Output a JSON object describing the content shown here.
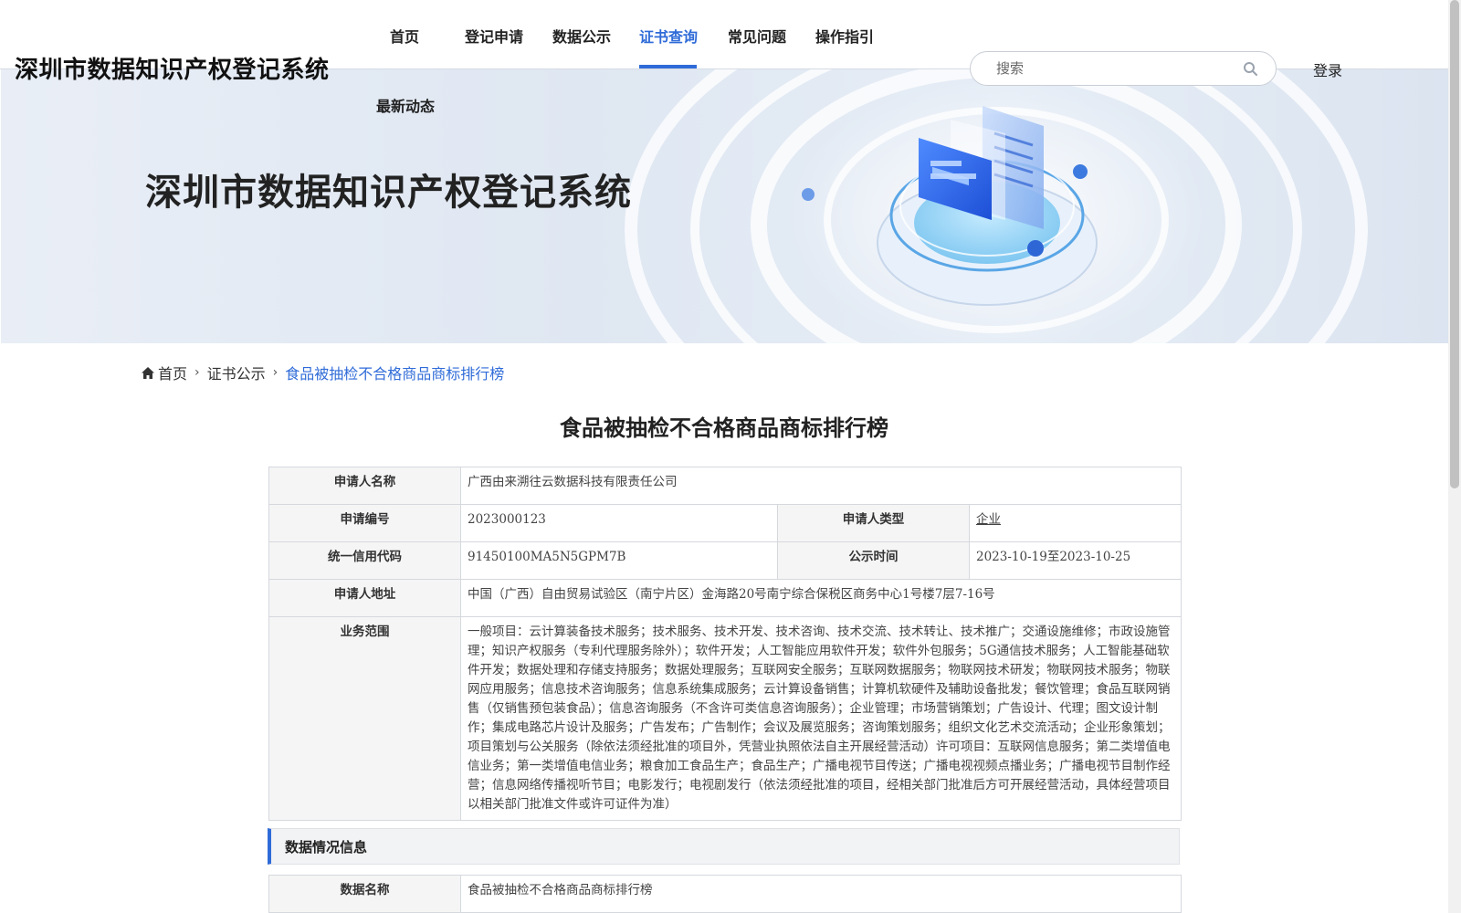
{
  "header": {
    "site_title": "深圳市数据知识产权登记系统",
    "nav": [
      {
        "label": "首页",
        "active": false
      },
      {
        "label": "登记申请",
        "active": false
      },
      {
        "label": "数据公示",
        "active": false
      },
      {
        "label": "证书查询",
        "active": true
      },
      {
        "label": "常见问题",
        "active": false
      },
      {
        "label": "操作指引",
        "active": false
      },
      {
        "label": "最新动态",
        "active": false
      }
    ],
    "search_placeholder": "搜索",
    "login_label": "登录",
    "accent_color": "#2f6bd8"
  },
  "banner": {
    "title": "深圳市数据知识产权登记系统"
  },
  "breadcrumb": {
    "items": [
      "首页",
      "证书公示",
      "食品被抽检不合格商品商标排行榜"
    ]
  },
  "page": {
    "title": "食品被抽检不合格商品商标排行榜"
  },
  "applicant": {
    "name_label": "申请人名称",
    "name": "广西由来溯往云数据科技有限责任公司",
    "app_no_label": "申请编号",
    "app_no": "2023000123",
    "type_label": "申请人类型",
    "type": "企业",
    "credit_code_label": "统一信用代码",
    "credit_code": "91450100MA5N5GPM7B",
    "publicity_label": "公示时间",
    "publicity": "2023-10-19至2023-10-25",
    "address_label": "申请人地址",
    "address": "中国（广西）自由贸易试验区（南宁片区）金海路20号南宁综合保税区商务中心1号楼7层7-16号",
    "scope_label": "业务范围",
    "scope": "一般项目：云计算装备技术服务；技术服务、技术开发、技术咨询、技术交流、技术转让、技术推广；交通设施维修；市政设施管理；知识产权服务（专利代理服务除外）；软件开发；人工智能应用软件开发；软件外包服务；5G通信技术服务；人工智能基础软件开发；数据处理和存储支持服务；数据处理服务；互联网安全服务；互联网数据服务；物联网技术研发；物联网技术服务；物联网应用服务；信息技术咨询服务；信息系统集成服务；云计算设备销售；计算机软硬件及辅助设备批发；餐饮管理；食品互联网销售（仅销售预包装食品）；信息咨询服务（不含许可类信息咨询服务）；企业管理；市场营销策划；广告设计、代理；图文设计制作；集成电路芯片设计及服务；广告发布；广告制作；会议及展览服务；咨询策划服务；组织文化艺术交流活动；企业形象策划；项目策划与公关服务（除依法须经批准的项目外，凭营业执照依法自主开展经营活动）许可项目：互联网信息服务；第二类增值电信业务；第一类增值电信业务；粮食加工食品生产；食品生产；广播电视节目传送；广播电视视频点播业务；广播电视节目制作经营；信息网络传播视听节目；电影发行；电视剧发行（依法须经批准的项目，经相关部门批准后方可开展经营活动，具体经营项目以相关部门批准文件或许可证件为准）"
  },
  "data_section": {
    "heading": "数据情况信息",
    "data_name_label": "数据名称",
    "data_name": "食品被抽检不合格商品商标排行榜"
  }
}
